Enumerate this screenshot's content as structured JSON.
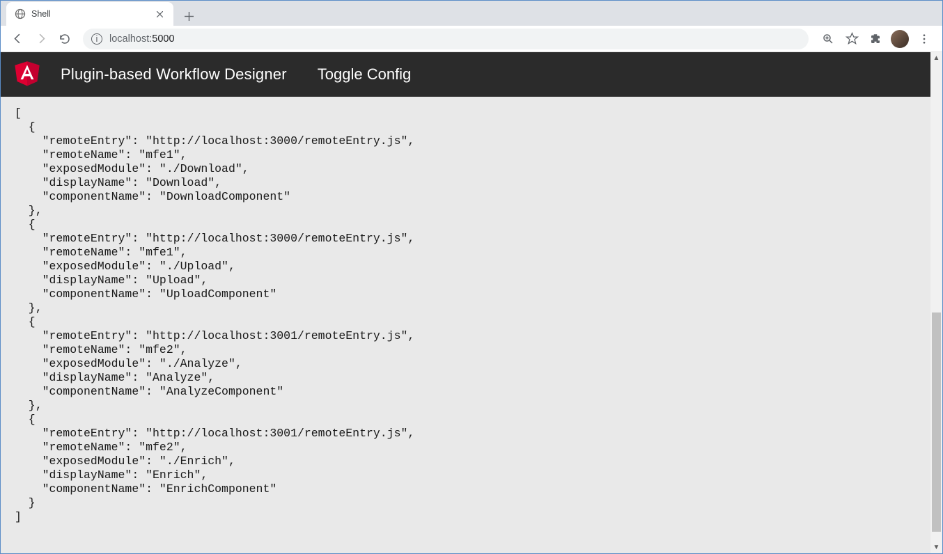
{
  "browser": {
    "tab_title": "Shell",
    "url_host": "localhost:",
    "url_port": "5000"
  },
  "header": {
    "title": "Plugin-based Workflow Designer",
    "toggle_label": "Toggle Config"
  },
  "config_json": "[\n  {\n    \"remoteEntry\": \"http://localhost:3000/remoteEntry.js\",\n    \"remoteName\": \"mfe1\",\n    \"exposedModule\": \"./Download\",\n    \"displayName\": \"Download\",\n    \"componentName\": \"DownloadComponent\"\n  },\n  {\n    \"remoteEntry\": \"http://localhost:3000/remoteEntry.js\",\n    \"remoteName\": \"mfe1\",\n    \"exposedModule\": \"./Upload\",\n    \"displayName\": \"Upload\",\n    \"componentName\": \"UploadComponent\"\n  },\n  {\n    \"remoteEntry\": \"http://localhost:3001/remoteEntry.js\",\n    \"remoteName\": \"mfe2\",\n    \"exposedModule\": \"./Analyze\",\n    \"displayName\": \"Analyze\",\n    \"componentName\": \"AnalyzeComponent\"\n  },\n  {\n    \"remoteEntry\": \"http://localhost:3001/remoteEntry.js\",\n    \"remoteName\": \"mfe2\",\n    \"exposedModule\": \"./Enrich\",\n    \"displayName\": \"Enrich\",\n    \"componentName\": \"EnrichComponent\"\n  }\n]",
  "config": [
    {
      "remoteEntry": "http://localhost:3000/remoteEntry.js",
      "remoteName": "mfe1",
      "exposedModule": "./Download",
      "displayName": "Download",
      "componentName": "DownloadComponent"
    },
    {
      "remoteEntry": "http://localhost:3000/remoteEntry.js",
      "remoteName": "mfe1",
      "exposedModule": "./Upload",
      "displayName": "Upload",
      "componentName": "UploadComponent"
    },
    {
      "remoteEntry": "http://localhost:3001/remoteEntry.js",
      "remoteName": "mfe2",
      "exposedModule": "./Analyze",
      "displayName": "Analyze",
      "componentName": "AnalyzeComponent"
    },
    {
      "remoteEntry": "http://localhost:3001/remoteEntry.js",
      "remoteName": "mfe2",
      "exposedModule": "./Enrich",
      "displayName": "Enrich",
      "componentName": "EnrichComponent"
    }
  ]
}
